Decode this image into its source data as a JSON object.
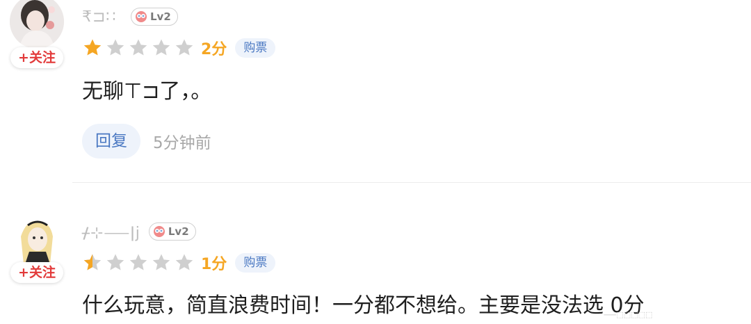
{
  "reviews": [
    {
      "username": "₹⊐∷",
      "level": "Lv2",
      "score_label": "2分",
      "stars": 1,
      "tag": "购票",
      "comment": "无聊⊤⊐了，。",
      "follow_label": "+关注",
      "reply_label": "回复",
      "time_ago": "5分钟前"
    },
    {
      "username": "ᚋ⊹⸺ǀj",
      "level": "Lv2",
      "score_label": "1分",
      "stars": 0.5,
      "tag": "购票",
      "comment": "什么玩意，简直浪费时间！一分都不想给。主要是没法选 0分",
      "follow_label": "+关注"
    }
  ],
  "colors": {
    "star_on": "#f5a623",
    "star_off": "#cfcfcf",
    "accent_red": "#e23a3a",
    "tag_blue": "#4a78c2",
    "tag_bg": "#eef3fb"
  },
  "watermark": "⸺⬚⬚⬚⬚⬚"
}
